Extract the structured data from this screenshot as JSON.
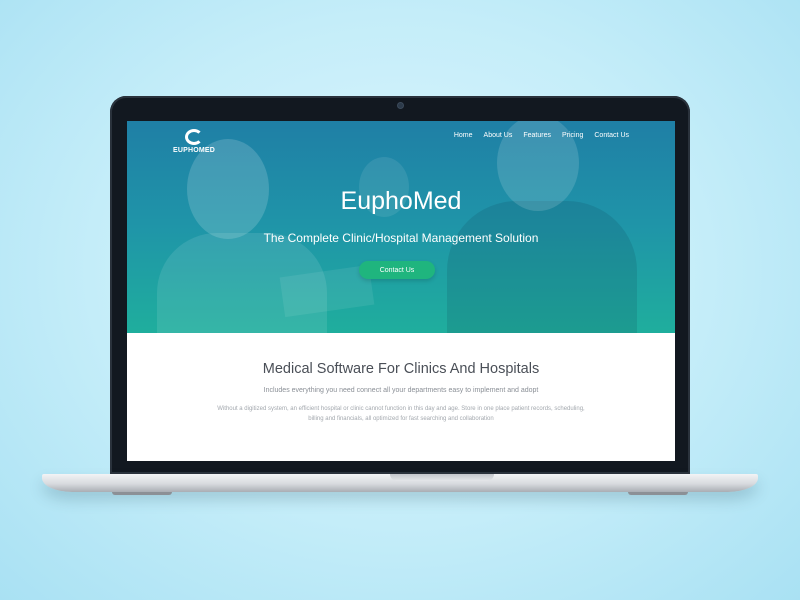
{
  "site": {
    "logo_text": "EUPHOMED",
    "nav": [
      {
        "label": "Home"
      },
      {
        "label": "About Us"
      },
      {
        "label": "Features"
      },
      {
        "label": "Pricing"
      },
      {
        "label": "Contact Us"
      }
    ]
  },
  "hero": {
    "title": "EuphoMed",
    "subtitle": "The Complete Clinic/Hospital Management Solution",
    "cta_label": "Contact Us",
    "gradient_top": "#1f7fa6",
    "gradient_bottom": "#1fae9d",
    "cta_color": "#1fb57e"
  },
  "section": {
    "title": "Medical Software For Clinics And Hospitals",
    "lead": "Includes everything you need connect all your departments easy to implement and adopt",
    "body": "Without a digitized system, an efficient hospital or clinic cannot function in this day and age. Store in one place patient records, scheduling, billing and financials, all optimized for fast searching and collaboration"
  }
}
